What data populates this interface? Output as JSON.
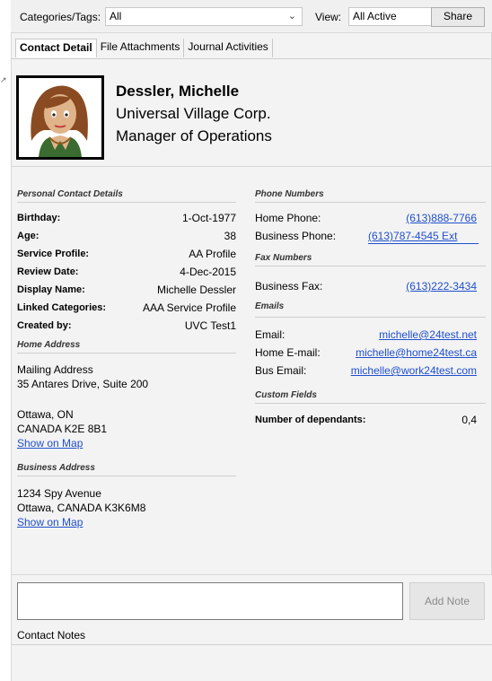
{
  "toolbar": {
    "categories_label": "Categories/Tags:",
    "categories_value": "All",
    "view_label": "View:",
    "view_value": "All Active",
    "share_label": "Share"
  },
  "tabs": [
    {
      "label": "Contact Detail",
      "active": true
    },
    {
      "label": "File Attachments",
      "active": false
    },
    {
      "label": "Journal Activities",
      "active": false
    }
  ],
  "contact": {
    "name": "Dessler, Michelle",
    "company": "Universal Village Corp.",
    "title": "Manager of Operations"
  },
  "personal": {
    "heading": "Personal Contact Details",
    "rows": [
      {
        "label": "Birthday:",
        "value": "1-Oct-1977"
      },
      {
        "label": "Age:",
        "value": "38"
      },
      {
        "label": "Service Profile:",
        "value": "AA Profile"
      },
      {
        "label": "Review Date:",
        "value": "4-Dec-2015"
      },
      {
        "label": "Display Name:",
        "value": "Michelle Dessler"
      },
      {
        "label": "Linked Categories:",
        "value": "AAA Service Profile"
      },
      {
        "label": "Created by:",
        "value": "UVC Test1"
      }
    ]
  },
  "home_address": {
    "heading": "Home Address",
    "line1": "Mailing Address",
    "line2": "35 Antares Drive, Suite 200",
    "line3": "Ottawa, ON",
    "line4": "CANADA K2E 8B1",
    "map_link": "Show on Map"
  },
  "business_address": {
    "heading": "Business Address",
    "line1": "1234 Spy Avenue",
    "line2": "Ottawa, CANADA K3K6M8",
    "map_link": "Show on Map"
  },
  "phones": {
    "heading": "Phone Numbers",
    "rows": [
      {
        "label": "Home Phone:",
        "value": "(613)888-7766"
      },
      {
        "label": "Business Phone:",
        "value": "(613)787-4545 Ext"
      }
    ]
  },
  "fax": {
    "heading": "Fax Numbers",
    "rows": [
      {
        "label": "Business Fax:",
        "value": "(613)222-3434"
      }
    ]
  },
  "emails": {
    "heading": "Emails",
    "rows": [
      {
        "label": "Email:",
        "value": "michelle@24test.net"
      },
      {
        "label": "Home E-mail:",
        "value": "michelle@home24test.ca"
      },
      {
        "label": "Bus Email:",
        "value": "michelle@work24test.com"
      }
    ]
  },
  "custom": {
    "heading": "Custom Fields",
    "rows": [
      {
        "label": "Number of dependants:",
        "value": "0,4"
      }
    ]
  },
  "notes": {
    "add_button": "Add Note",
    "label": "Contact Notes"
  },
  "colors": {
    "link": "#1f4fcc",
    "panel_bg": "#f3f3f3"
  }
}
